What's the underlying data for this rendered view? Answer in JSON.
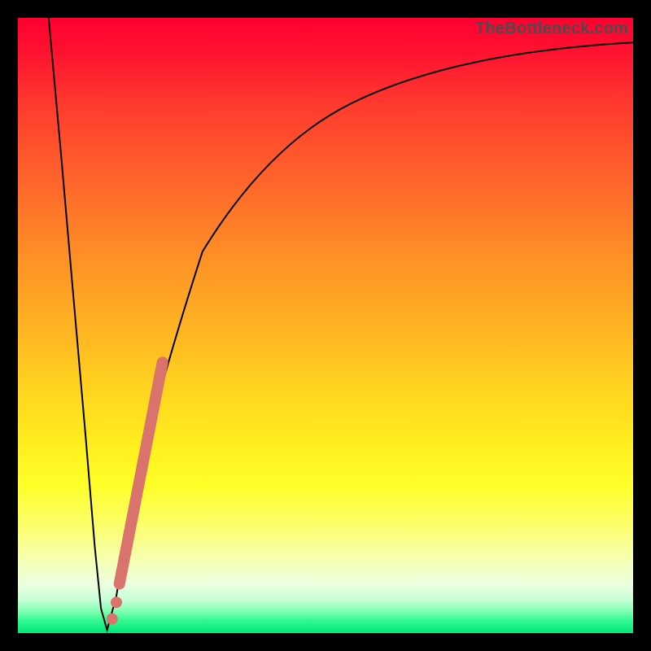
{
  "watermark": "TheBottleneck.com",
  "chart_data": {
    "type": "line",
    "title": "",
    "xlabel": "",
    "ylabel": "",
    "xlim": [
      0,
      100
    ],
    "ylim": [
      0,
      100
    ],
    "grid": false,
    "legend": false,
    "series": [
      {
        "name": "bottleneck-curve",
        "color": "#000000",
        "x": [
          5,
          7,
          9,
          11,
          12.5,
          13.5,
          14.5,
          16,
          18,
          20,
          22,
          25,
          30,
          36,
          44,
          54,
          66,
          80,
          94,
          100
        ],
        "y": [
          100,
          78,
          55,
          32,
          14,
          4,
          0.5,
          6,
          18,
          30,
          40,
          50,
          62,
          72,
          80,
          86,
          90.5,
          93.5,
          95.5,
          96
        ]
      },
      {
        "name": "highlight-segment-main",
        "color": "#d9736b",
        "x": [
          16.5,
          23.5
        ],
        "y": [
          8,
          44
        ]
      },
      {
        "name": "highlight-dot-high",
        "color": "#d9736b",
        "x": [
          16.0
        ],
        "y": [
          5.0
        ]
      },
      {
        "name": "highlight-dot-low",
        "color": "#d9736b",
        "x": [
          15.3
        ],
        "y": [
          2.3
        ]
      }
    ],
    "gradient_stops": [
      {
        "pos": 0.0,
        "color": "#ff0030"
      },
      {
        "pos": 0.15,
        "color": "#ff3e2e"
      },
      {
        "pos": 0.4,
        "color": "#ff9426"
      },
      {
        "pos": 0.62,
        "color": "#ffd91f"
      },
      {
        "pos": 0.82,
        "color": "#fcff66"
      },
      {
        "pos": 0.92,
        "color": "#ecffe0"
      },
      {
        "pos": 0.97,
        "color": "#7effb0"
      },
      {
        "pos": 1.0,
        "color": "#00e676"
      }
    ]
  }
}
